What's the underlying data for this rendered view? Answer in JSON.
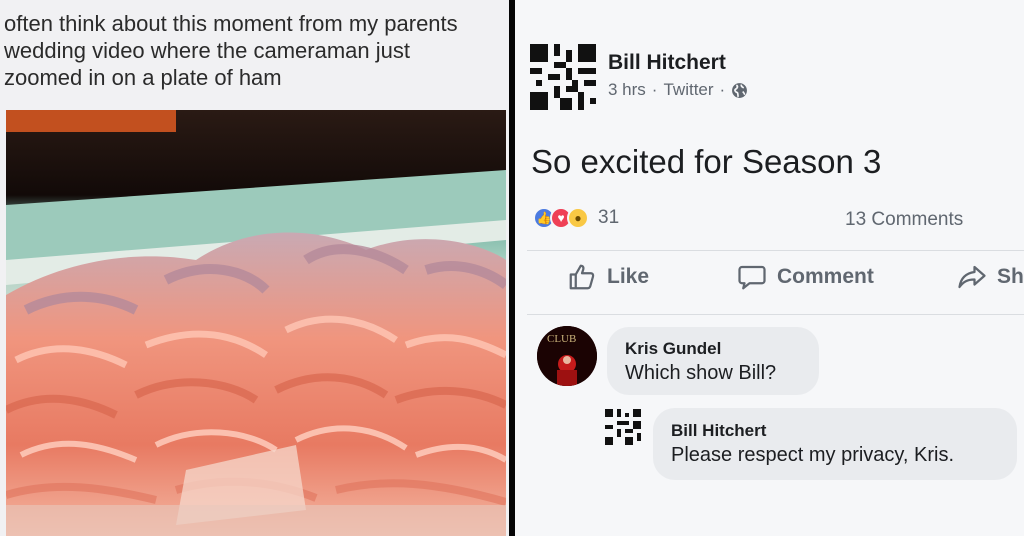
{
  "meme_caption": {
    "lines": [
      "often think about this moment from my parents",
      "wedding video where the cameraman just",
      "zoomed in on a plate of ham"
    ]
  },
  "photo": {
    "subject": "plate of folded ham slices"
  },
  "post": {
    "author": "Bill Hitchert",
    "time": "3 hrs",
    "source": "Twitter",
    "separator": "·",
    "privacy_icon": "globe-icon",
    "text": "So excited for Season 3",
    "reaction_count": "31",
    "reaction_icons": [
      "like-reaction-icon",
      "love-reaction-icon",
      "wow-reaction-icon"
    ],
    "comments_label": "13 Comments"
  },
  "actions": {
    "like": "Like",
    "comment": "Comment",
    "share": "Sh"
  },
  "comments": [
    {
      "author": "Kris Gundel",
      "text": "Which show Bill?",
      "avatar_text": "CLUB"
    },
    {
      "author": "Bill Hitchert",
      "text": "Please respect my privacy, Kris."
    }
  ],
  "colors": {
    "facebook_like": "#4c7be0",
    "love": "#ef4056",
    "wow": "#f9c844",
    "secondary_text": "#606770",
    "bubble": "#e9ebee",
    "ham": "#f0957e"
  }
}
